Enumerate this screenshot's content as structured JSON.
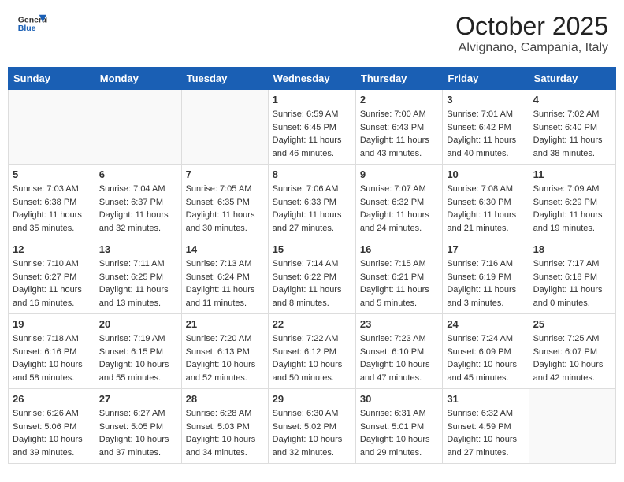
{
  "header": {
    "logo_general": "General",
    "logo_blue": "Blue",
    "month_title": "October 2025",
    "location": "Alvignano, Campania, Italy"
  },
  "weekdays": [
    "Sunday",
    "Monday",
    "Tuesday",
    "Wednesday",
    "Thursday",
    "Friday",
    "Saturday"
  ],
  "weeks": [
    [
      {
        "day": "",
        "info": ""
      },
      {
        "day": "",
        "info": ""
      },
      {
        "day": "",
        "info": ""
      },
      {
        "day": "1",
        "info": "Sunrise: 6:59 AM\nSunset: 6:45 PM\nDaylight: 11 hours\nand 46 minutes."
      },
      {
        "day": "2",
        "info": "Sunrise: 7:00 AM\nSunset: 6:43 PM\nDaylight: 11 hours\nand 43 minutes."
      },
      {
        "day": "3",
        "info": "Sunrise: 7:01 AM\nSunset: 6:42 PM\nDaylight: 11 hours\nand 40 minutes."
      },
      {
        "day": "4",
        "info": "Sunrise: 7:02 AM\nSunset: 6:40 PM\nDaylight: 11 hours\nand 38 minutes."
      }
    ],
    [
      {
        "day": "5",
        "info": "Sunrise: 7:03 AM\nSunset: 6:38 PM\nDaylight: 11 hours\nand 35 minutes."
      },
      {
        "day": "6",
        "info": "Sunrise: 7:04 AM\nSunset: 6:37 PM\nDaylight: 11 hours\nand 32 minutes."
      },
      {
        "day": "7",
        "info": "Sunrise: 7:05 AM\nSunset: 6:35 PM\nDaylight: 11 hours\nand 30 minutes."
      },
      {
        "day": "8",
        "info": "Sunrise: 7:06 AM\nSunset: 6:33 PM\nDaylight: 11 hours\nand 27 minutes."
      },
      {
        "day": "9",
        "info": "Sunrise: 7:07 AM\nSunset: 6:32 PM\nDaylight: 11 hours\nand 24 minutes."
      },
      {
        "day": "10",
        "info": "Sunrise: 7:08 AM\nSunset: 6:30 PM\nDaylight: 11 hours\nand 21 minutes."
      },
      {
        "day": "11",
        "info": "Sunrise: 7:09 AM\nSunset: 6:29 PM\nDaylight: 11 hours\nand 19 minutes."
      }
    ],
    [
      {
        "day": "12",
        "info": "Sunrise: 7:10 AM\nSunset: 6:27 PM\nDaylight: 11 hours\nand 16 minutes."
      },
      {
        "day": "13",
        "info": "Sunrise: 7:11 AM\nSunset: 6:25 PM\nDaylight: 11 hours\nand 13 minutes."
      },
      {
        "day": "14",
        "info": "Sunrise: 7:13 AM\nSunset: 6:24 PM\nDaylight: 11 hours\nand 11 minutes."
      },
      {
        "day": "15",
        "info": "Sunrise: 7:14 AM\nSunset: 6:22 PM\nDaylight: 11 hours\nand 8 minutes."
      },
      {
        "day": "16",
        "info": "Sunrise: 7:15 AM\nSunset: 6:21 PM\nDaylight: 11 hours\nand 5 minutes."
      },
      {
        "day": "17",
        "info": "Sunrise: 7:16 AM\nSunset: 6:19 PM\nDaylight: 11 hours\nand 3 minutes."
      },
      {
        "day": "18",
        "info": "Sunrise: 7:17 AM\nSunset: 6:18 PM\nDaylight: 11 hours\nand 0 minutes."
      }
    ],
    [
      {
        "day": "19",
        "info": "Sunrise: 7:18 AM\nSunset: 6:16 PM\nDaylight: 10 hours\nand 58 minutes."
      },
      {
        "day": "20",
        "info": "Sunrise: 7:19 AM\nSunset: 6:15 PM\nDaylight: 10 hours\nand 55 minutes."
      },
      {
        "day": "21",
        "info": "Sunrise: 7:20 AM\nSunset: 6:13 PM\nDaylight: 10 hours\nand 52 minutes."
      },
      {
        "day": "22",
        "info": "Sunrise: 7:22 AM\nSunset: 6:12 PM\nDaylight: 10 hours\nand 50 minutes."
      },
      {
        "day": "23",
        "info": "Sunrise: 7:23 AM\nSunset: 6:10 PM\nDaylight: 10 hours\nand 47 minutes."
      },
      {
        "day": "24",
        "info": "Sunrise: 7:24 AM\nSunset: 6:09 PM\nDaylight: 10 hours\nand 45 minutes."
      },
      {
        "day": "25",
        "info": "Sunrise: 7:25 AM\nSunset: 6:07 PM\nDaylight: 10 hours\nand 42 minutes."
      }
    ],
    [
      {
        "day": "26",
        "info": "Sunrise: 6:26 AM\nSunset: 5:06 PM\nDaylight: 10 hours\nand 39 minutes."
      },
      {
        "day": "27",
        "info": "Sunrise: 6:27 AM\nSunset: 5:05 PM\nDaylight: 10 hours\nand 37 minutes."
      },
      {
        "day": "28",
        "info": "Sunrise: 6:28 AM\nSunset: 5:03 PM\nDaylight: 10 hours\nand 34 minutes."
      },
      {
        "day": "29",
        "info": "Sunrise: 6:30 AM\nSunset: 5:02 PM\nDaylight: 10 hours\nand 32 minutes."
      },
      {
        "day": "30",
        "info": "Sunrise: 6:31 AM\nSunset: 5:01 PM\nDaylight: 10 hours\nand 29 minutes."
      },
      {
        "day": "31",
        "info": "Sunrise: 6:32 AM\nSunset: 4:59 PM\nDaylight: 10 hours\nand 27 minutes."
      },
      {
        "day": "",
        "info": ""
      }
    ]
  ]
}
